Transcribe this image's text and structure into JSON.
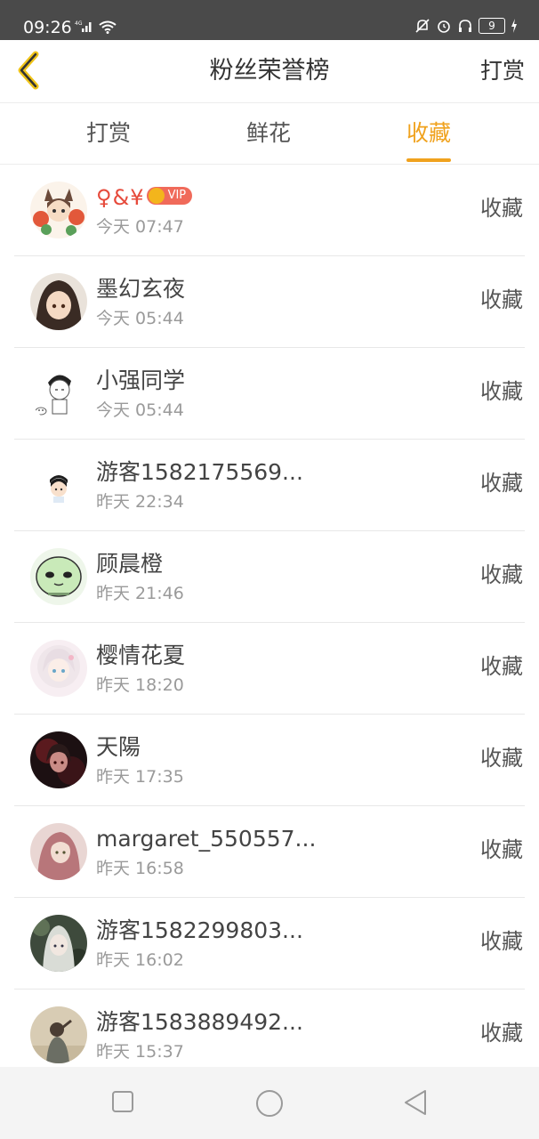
{
  "status_bar": {
    "time": "09:26",
    "network": "4G",
    "battery": "9"
  },
  "header": {
    "title": "粉丝荣誉榜",
    "action_label": "打赏",
    "back_icon": "chevron-left-icon",
    "accent_color": "#f0a21e"
  },
  "tabs": [
    {
      "label": "打赏",
      "active": false
    },
    {
      "label": "鲜花",
      "active": false
    },
    {
      "label": "收藏",
      "active": true
    }
  ],
  "fans": [
    {
      "name": "♀&¥",
      "vip": true,
      "vip_label": "VIP",
      "time": "今天 07:47",
      "action": "收藏",
      "avatar": "fox-girl-flowers"
    },
    {
      "name": "墨幻玄夜",
      "vip": false,
      "time": "今天 05:44",
      "action": "收藏",
      "avatar": "anime-boy"
    },
    {
      "name": "小强同学",
      "vip": false,
      "time": "今天 05:44",
      "action": "收藏",
      "avatar": "cartoon-boy-cat"
    },
    {
      "name": "游客1582175569...",
      "vip": false,
      "time": "昨天 22:34",
      "action": "收藏",
      "avatar": "small-boy"
    },
    {
      "name": "顾晨橙",
      "vip": false,
      "time": "昨天 21:46",
      "action": "收藏",
      "avatar": "green-blob"
    },
    {
      "name": "樱情花夏",
      "vip": false,
      "time": "昨天 18:20",
      "action": "收藏",
      "avatar": "white-hair-girl"
    },
    {
      "name": "天陽",
      "vip": false,
      "time": "昨天 17:35",
      "action": "收藏",
      "avatar": "dark-red-portrait"
    },
    {
      "name": "margaret_550557...",
      "vip": false,
      "time": "昨天 16:58",
      "action": "收藏",
      "avatar": "pink-hair-girl"
    },
    {
      "name": "游客1582299803...",
      "vip": false,
      "time": "昨天 16:02",
      "action": "收藏",
      "avatar": "silver-hair-character"
    },
    {
      "name": "游客1583889492...",
      "vip": false,
      "time": "昨天 15:37",
      "action": "收藏",
      "avatar": "person-back-view"
    }
  ],
  "nav_bar": {
    "icons": [
      "recents-square-icon",
      "home-circle-icon",
      "back-triangle-icon"
    ]
  }
}
